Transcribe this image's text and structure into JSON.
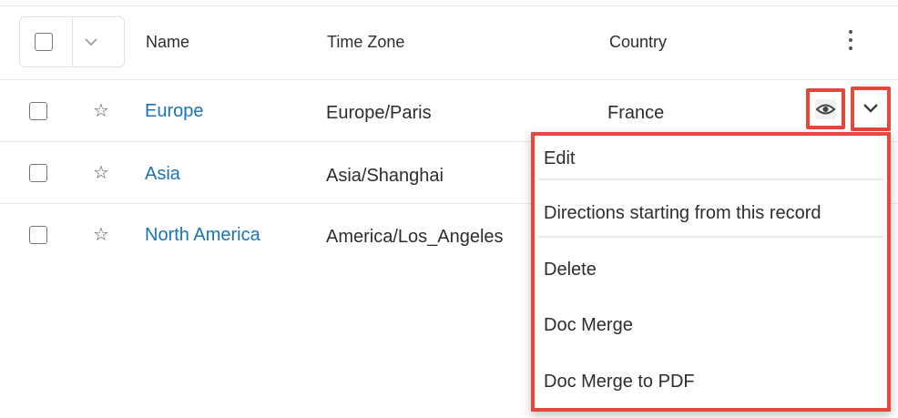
{
  "table": {
    "columns": [
      "Name",
      "Time Zone",
      "Country"
    ],
    "rows": [
      {
        "name": "Europe",
        "time_zone": "Europe/Paris",
        "country": "France"
      },
      {
        "name": "Asia",
        "time_zone": "Asia/Shanghai",
        "country": ""
      },
      {
        "name": "North America",
        "time_zone": "America/Los_Angeles",
        "country": ""
      }
    ]
  },
  "row_actions": {
    "icons": [
      "eye-icon",
      "chevron-down-icon"
    ],
    "menu_items": [
      "Edit",
      "Directions starting from this record",
      "Delete",
      "Doc Merge",
      "Doc Merge to PDF"
    ]
  },
  "colors": {
    "link": "#1a73b8",
    "highlight": "#e0493b",
    "border": "#e6e8ea"
  }
}
